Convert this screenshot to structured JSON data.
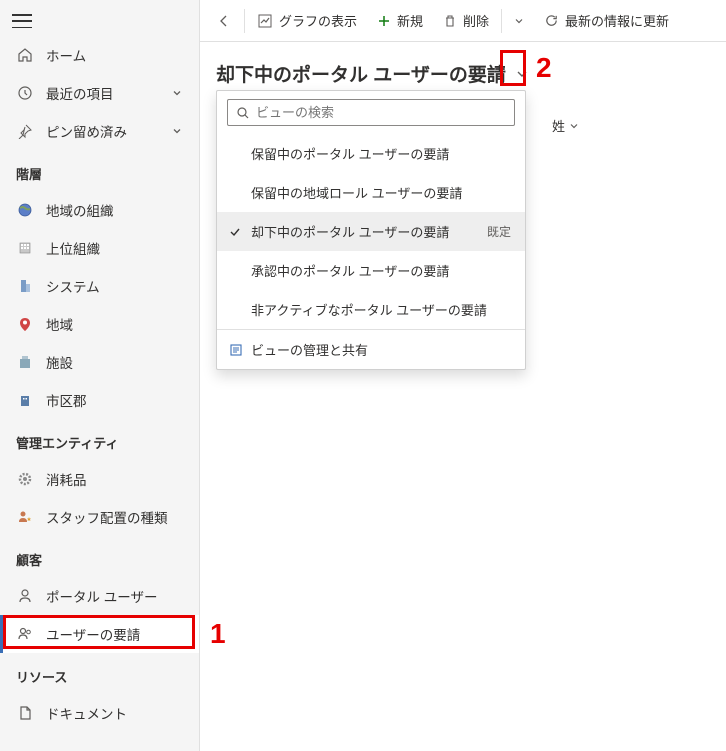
{
  "sidebar": {
    "top": {
      "home": "ホーム",
      "recent": "最近の項目",
      "pinned": "ピン留め済み"
    },
    "sections": [
      {
        "header": "階層",
        "items": [
          {
            "label": "地域の組織",
            "icon": "globe"
          },
          {
            "label": "上位組織",
            "icon": "building-grid"
          },
          {
            "label": "システム",
            "icon": "building"
          },
          {
            "label": "地域",
            "icon": "map-pin"
          },
          {
            "label": "施設",
            "icon": "facility"
          },
          {
            "label": "市区郡",
            "icon": "city"
          }
        ]
      },
      {
        "header": "管理エンティティ",
        "items": [
          {
            "label": "消耗品",
            "icon": "gear"
          },
          {
            "label": "スタッフ配置の種類",
            "icon": "person-star"
          }
        ]
      },
      {
        "header": "顧客",
        "items": [
          {
            "label": "ポータル ユーザー",
            "icon": "person"
          },
          {
            "label": "ユーザーの要請",
            "icon": "people",
            "selected": true
          }
        ]
      },
      {
        "header": "リソース",
        "items": [
          {
            "label": "ドキュメント",
            "icon": "document"
          }
        ]
      }
    ]
  },
  "toolbar": {
    "graph": "グラフの表示",
    "new": "新規",
    "delete": "削除",
    "refresh": "最新の情報に更新"
  },
  "view": {
    "title": "却下中のポータル ユーザーの要請",
    "search_placeholder": "ビューの検索",
    "options": [
      {
        "label": "保留中のポータル ユーザーの要請",
        "selected": false
      },
      {
        "label": "保留中の地域ロール ユーザーの要請",
        "selected": false
      },
      {
        "label": "却下中のポータル ユーザーの要請",
        "selected": true,
        "default_badge": "既定"
      },
      {
        "label": "承認中のポータル ユーザーの要請",
        "selected": false
      },
      {
        "label": "非アクティブなポータル ユーザーの要請",
        "selected": false
      }
    ],
    "manage": "ビューの管理と共有"
  },
  "columns": {
    "lastname": "姓"
  },
  "annotations": {
    "step1": "1",
    "step2": "2"
  }
}
